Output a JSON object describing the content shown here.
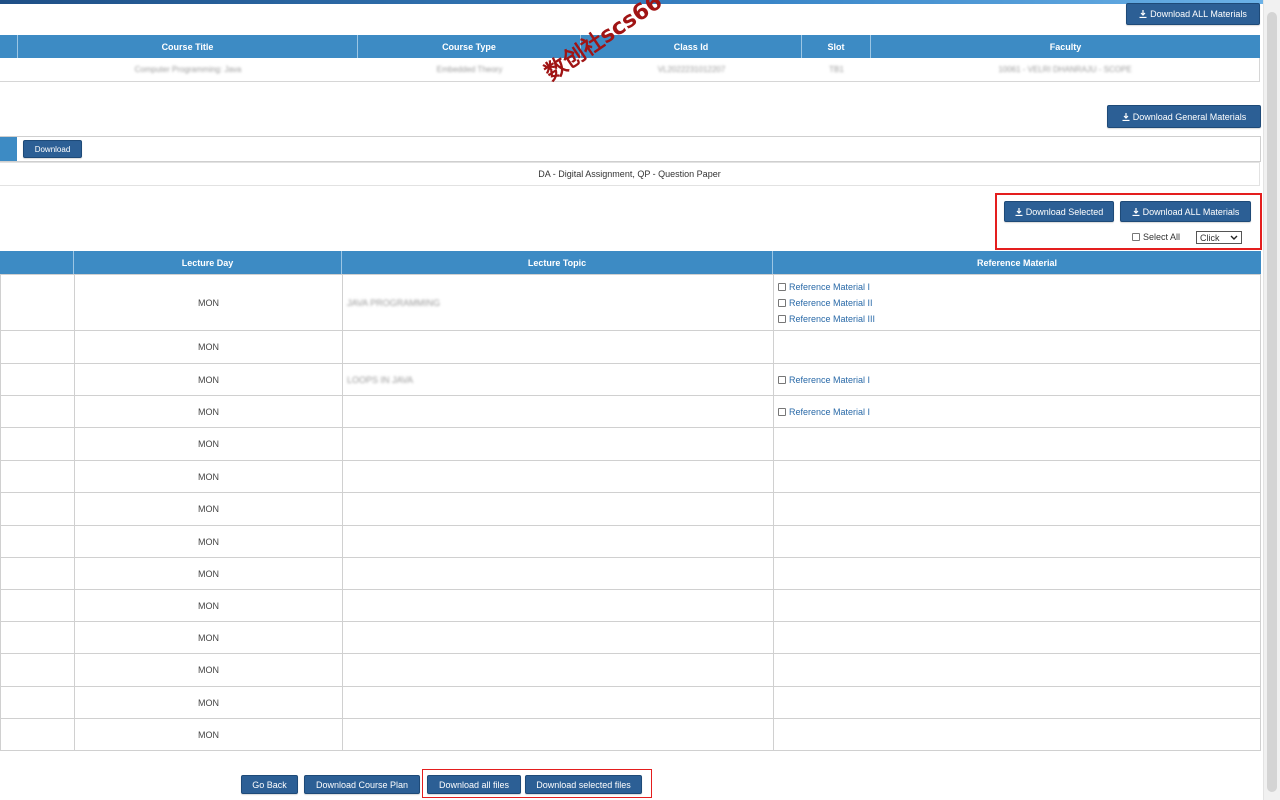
{
  "top": {
    "download_all_label": "Download ALL Materials"
  },
  "course_table": {
    "headers": [
      "Course Title",
      "Course Type",
      "Class Id",
      "Slot",
      "Faculty"
    ],
    "row": [
      "Computer Programming: Java",
      "Embedded Theory",
      "VL2022231012207",
      "TB1",
      "10061 - VELRI DHANRAJU - SCOPE"
    ]
  },
  "general": {
    "download_general_label": "Download General Materials",
    "download_label": "Download",
    "legend": "DA - Digital Assignment, QP - Question Paper"
  },
  "selection": {
    "download_selected_label": "Download Selected",
    "download_all_label": "Download ALL Materials",
    "select_all_label": "Select All",
    "select_value": "Click"
  },
  "lecture_table": {
    "headers": [
      "Lecture Day",
      "Lecture Topic",
      "Reference Material"
    ],
    "rows": [
      {
        "day": "MON",
        "topic": "JAVA PROGRAMMING",
        "refs": [
          "Reference Material I",
          "Reference Material II",
          "Reference Material III"
        ]
      },
      {
        "day": "MON",
        "topic": "",
        "refs": []
      },
      {
        "day": "MON",
        "topic": "LOOPS IN JAVA",
        "refs": [
          "Reference Material I"
        ]
      },
      {
        "day": "MON",
        "topic": "",
        "refs": [
          "Reference Material I"
        ]
      },
      {
        "day": "MON",
        "topic": "",
        "refs": []
      },
      {
        "day": "MON",
        "topic": "",
        "refs": []
      },
      {
        "day": "MON",
        "topic": "",
        "refs": []
      },
      {
        "day": "MON",
        "topic": "",
        "refs": []
      },
      {
        "day": "MON",
        "topic": "",
        "refs": []
      },
      {
        "day": "MON",
        "topic": "",
        "refs": []
      },
      {
        "day": "MON",
        "topic": "",
        "refs": []
      },
      {
        "day": "MON",
        "topic": "",
        "refs": []
      },
      {
        "day": "MON",
        "topic": "",
        "refs": []
      },
      {
        "day": "MON",
        "topic": "",
        "refs": []
      }
    ]
  },
  "footer": {
    "go_back": "Go Back",
    "download_course_plan": "Download Course Plan",
    "download_all_files": "Download all files",
    "download_selected_files": "Download selected files"
  },
  "watermark": "数创社scs66",
  "colors": {
    "header_blue": "#3d8bc4",
    "button_blue": "#2c5f95",
    "highlight_red": "#e41e1e",
    "link_blue": "#2a6aa8"
  }
}
